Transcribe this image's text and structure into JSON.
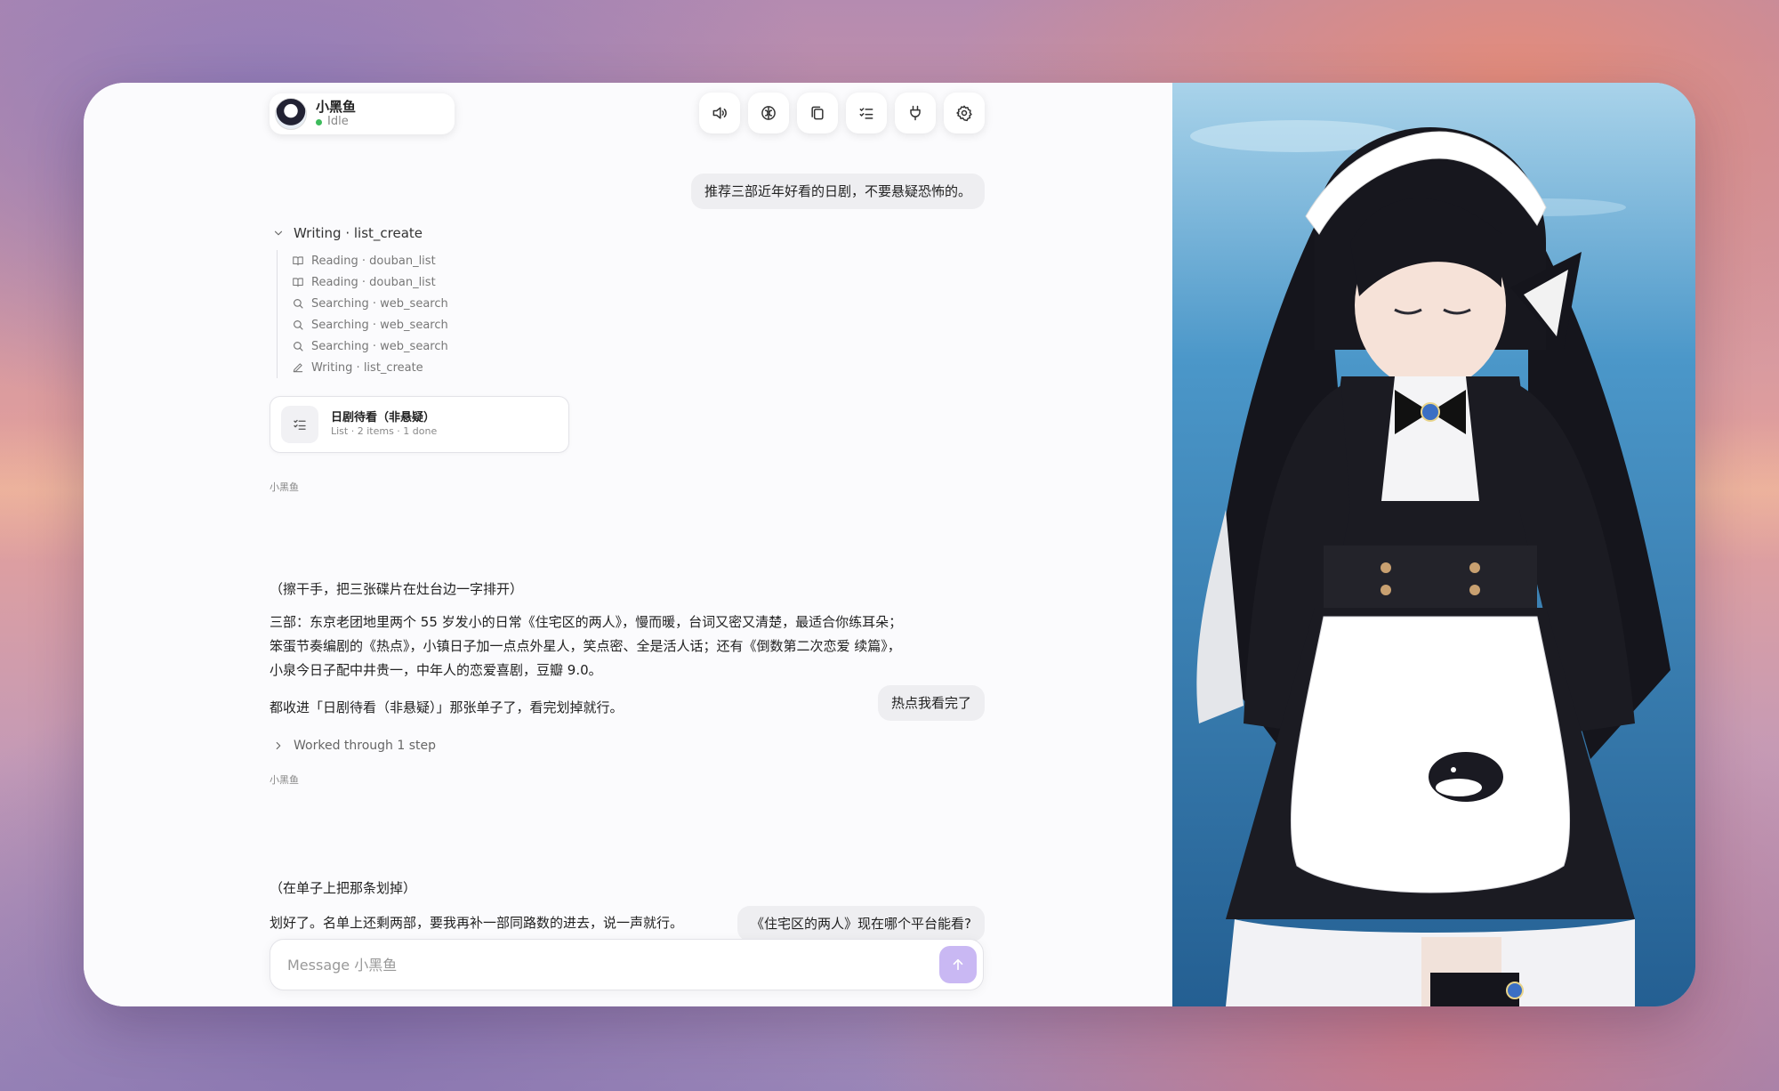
{
  "agent": {
    "name": "小黑鱼",
    "status": "Idle"
  },
  "toolbar": {
    "buttons": [
      "speaker-icon",
      "brain-icon",
      "copy-icon",
      "checklist-icon",
      "plug-icon",
      "gear-icon"
    ]
  },
  "conversation": {
    "user_msg_1": "推荐三部近年好看的日剧，不要悬疑恐怖的。",
    "tool_group": {
      "title": "Writing · list_create",
      "steps": [
        {
          "icon": "book-icon",
          "label": "Reading · douban_list"
        },
        {
          "icon": "book-icon",
          "label": "Reading · douban_list"
        },
        {
          "icon": "search-icon",
          "label": "Searching · web_search"
        },
        {
          "icon": "search-icon",
          "label": "Searching · web_search"
        },
        {
          "icon": "search-icon",
          "label": "Searching · web_search"
        },
        {
          "icon": "pencil-icon",
          "label": "Writing · list_create"
        }
      ]
    },
    "list_card": {
      "title": "日剧待看（非悬疑）",
      "subtitle": "List · 2 items · 1 done"
    },
    "reply_1": {
      "speaker": "小黑鱼",
      "action": "（擦干手，把三张碟片在灶台边一字排开）",
      "para": "三部：东京老团地里两个 55 岁发小的日常《住宅区的两人》，慢而暖，台词又密又清楚，最适合你练耳朵；笨蛋节奏编剧的《热点》，小镇日子加一点点外星人，笑点密、全是活人话；还有《倒数第二次恋爱 续篇》，小泉今日子配中井贵一，中年人的恋爱喜剧，豆瓣 9.0。",
      "closing": "都收进「日剧待看（非悬疑）」那张单子了，看完划掉就行。"
    },
    "user_msg_2": "热点我看完了",
    "worked": "Worked through 1 step",
    "reply_2": {
      "speaker": "小黑鱼",
      "action": "（在单子上把那条划掉）",
      "text": "划好了。名单上还剩两部，要我再补一部同路数的进去，说一声就行。"
    },
    "user_msg_3": "《住宅区的两人》现在哪个平台能看?"
  },
  "composer": {
    "placeholder": "Message 小黑鱼",
    "value": ""
  },
  "colors": {
    "accent": "#c9b8f3",
    "status_idle": "#3dbb5c"
  }
}
